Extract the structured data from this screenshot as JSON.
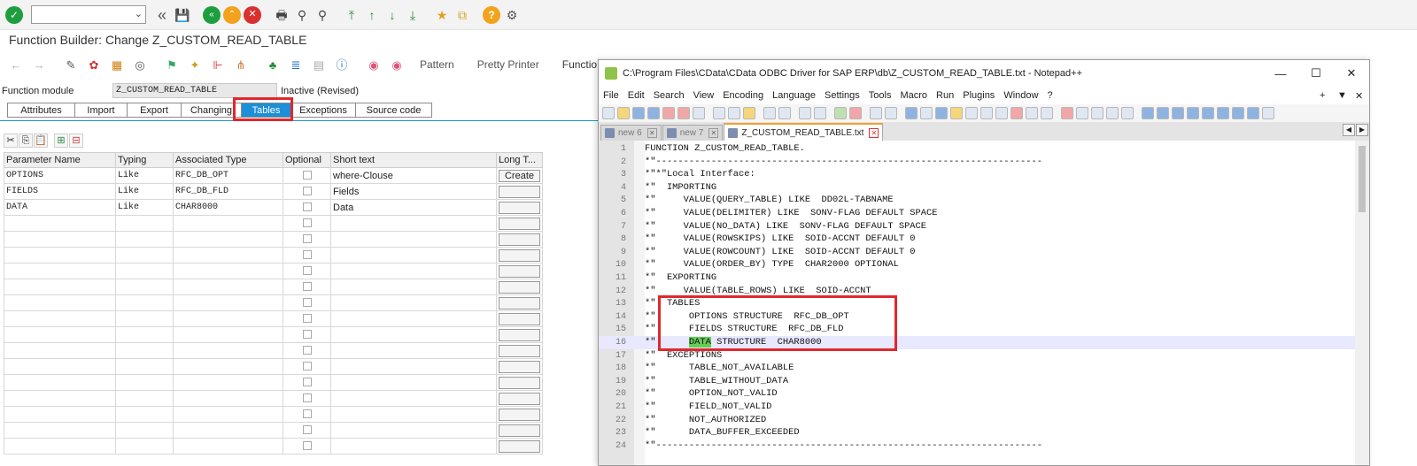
{
  "sap": {
    "title": "Function Builder: Change Z_CUSTOM_READ_TABLE",
    "app_toolbar": {
      "pattern": "Pattern",
      "pretty_printer": "Pretty Printer",
      "function_module_doc": "Function Module Documentation",
      "truncated_doc": "Functio"
    },
    "header": {
      "fm_label": "Function module",
      "fm_value": "Z_CUSTOM_READ_TABLE",
      "status": "Inactive (Revised)"
    },
    "tabs": [
      "Attributes",
      "Import",
      "Export",
      "Changing",
      "Tables",
      "Exceptions",
      "Source code"
    ],
    "active_tab": "Tables",
    "columns": [
      "Parameter Name",
      "Typing",
      "Associated Type",
      "Optional",
      "Short text",
      "Long T..."
    ],
    "rows": [
      {
        "name": "OPTIONS",
        "typing": "Like",
        "type": "RFC_DB_OPT",
        "short": "where-Clouse",
        "long": "Create"
      },
      {
        "name": "FIELDS",
        "typing": "Like",
        "type": "RFC_DB_FLD",
        "short": "Fields",
        "long": ""
      },
      {
        "name": "DATA",
        "typing": "Like",
        "type": "CHAR8000",
        "short": "Data",
        "long": ""
      }
    ]
  },
  "notepad": {
    "title": "C:\\Program Files\\CData\\CData ODBC Driver for SAP ERP\\db\\Z_CUSTOM_READ_TABLE.txt - Notepad++",
    "menu": [
      "File",
      "Edit",
      "Search",
      "View",
      "Encoding",
      "Language",
      "Settings",
      "Tools",
      "Macro",
      "Run",
      "Plugins",
      "Window",
      "?"
    ],
    "menu_right": {
      "plus": "+",
      "down": "▼",
      "close": "✕"
    },
    "tabs": [
      {
        "label": "new 6"
      },
      {
        "label": "new 7"
      },
      {
        "label": "Z_CUSTOM_READ_TABLE.txt"
      }
    ],
    "window_controls": {
      "minimize": "—",
      "maximize": "☐",
      "close": "✕"
    },
    "lines": [
      "FUNCTION Z_CUSTOM_READ_TABLE.",
      "*\"----------------------------------------------------------------------",
      "*\"*\"Local Interface:",
      "*\"  IMPORTING",
      "*\"     VALUE(QUERY_TABLE) LIKE  DD02L-TABNAME",
      "*\"     VALUE(DELIMITER) LIKE  SONV-FLAG DEFAULT SPACE",
      "*\"     VALUE(NO_DATA) LIKE  SONV-FLAG DEFAULT SPACE",
      "*\"     VALUE(ROWSKIPS) LIKE  SOID-ACCNT DEFAULT 0",
      "*\"     VALUE(ROWCOUNT) LIKE  SOID-ACCNT DEFAULT 0",
      "*\"     VALUE(ORDER_BY) TYPE  CHAR2000 OPTIONAL",
      "*\"  EXPORTING",
      "*\"     VALUE(TABLE_ROWS) LIKE  SOID-ACCNT",
      "*\"  TABLES",
      "*\"      OPTIONS STRUCTURE  RFC_DB_OPT",
      "*\"      FIELDS STRUCTURE  RFC_DB_FLD",
      "*\"      DATA STRUCTURE  CHAR8000",
      "*\"  EXCEPTIONS",
      "*\"      TABLE_NOT_AVAILABLE",
      "*\"      TABLE_WITHOUT_DATA",
      "*\"      OPTION_NOT_VALID",
      "*\"      FIELD_NOT_VALID",
      "*\"      NOT_AUTHORIZED",
      "*\"      DATA_BUFFER_EXCEEDED",
      "*\"----------------------------------------------------------------------"
    ]
  },
  "colors": {
    "accent": "#1d8fd8",
    "highlight_box": "#e0282c",
    "selection": "#66cc55"
  }
}
